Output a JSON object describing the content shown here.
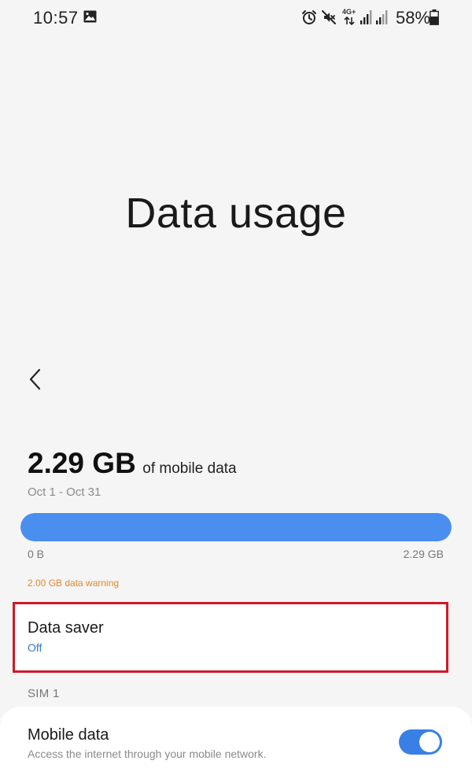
{
  "status_bar": {
    "time": "10:57",
    "network_type": "4G+",
    "battery_percent": "58%",
    "icons": [
      "gallery-icon",
      "alarm-icon",
      "mute-icon",
      "signal-icon",
      "signal-icon",
      "battery-icon"
    ]
  },
  "page": {
    "title": "Data usage",
    "back_icon": "chevron-left-icon"
  },
  "usage": {
    "amount": "2.29 GB",
    "suffix": "of mobile data",
    "period": "Oct 1 - Oct 31",
    "bar_fill_fraction": 1.0,
    "bar_min_label": "0 B",
    "bar_max_label": "2.29 GB",
    "warning": "2.00 GB data warning",
    "colors": {
      "bar": "#4a8ff0",
      "warning": "#e0882c"
    }
  },
  "data_saver": {
    "title": "Data saver",
    "status": "Off",
    "highlight_color": "#d0182a"
  },
  "sim_section": {
    "header": "SIM 1"
  },
  "mobile_data": {
    "title": "Mobile data",
    "description": "Access the internet through your mobile network.",
    "toggle_on": true,
    "toggle_color": "#3a7fe6"
  }
}
